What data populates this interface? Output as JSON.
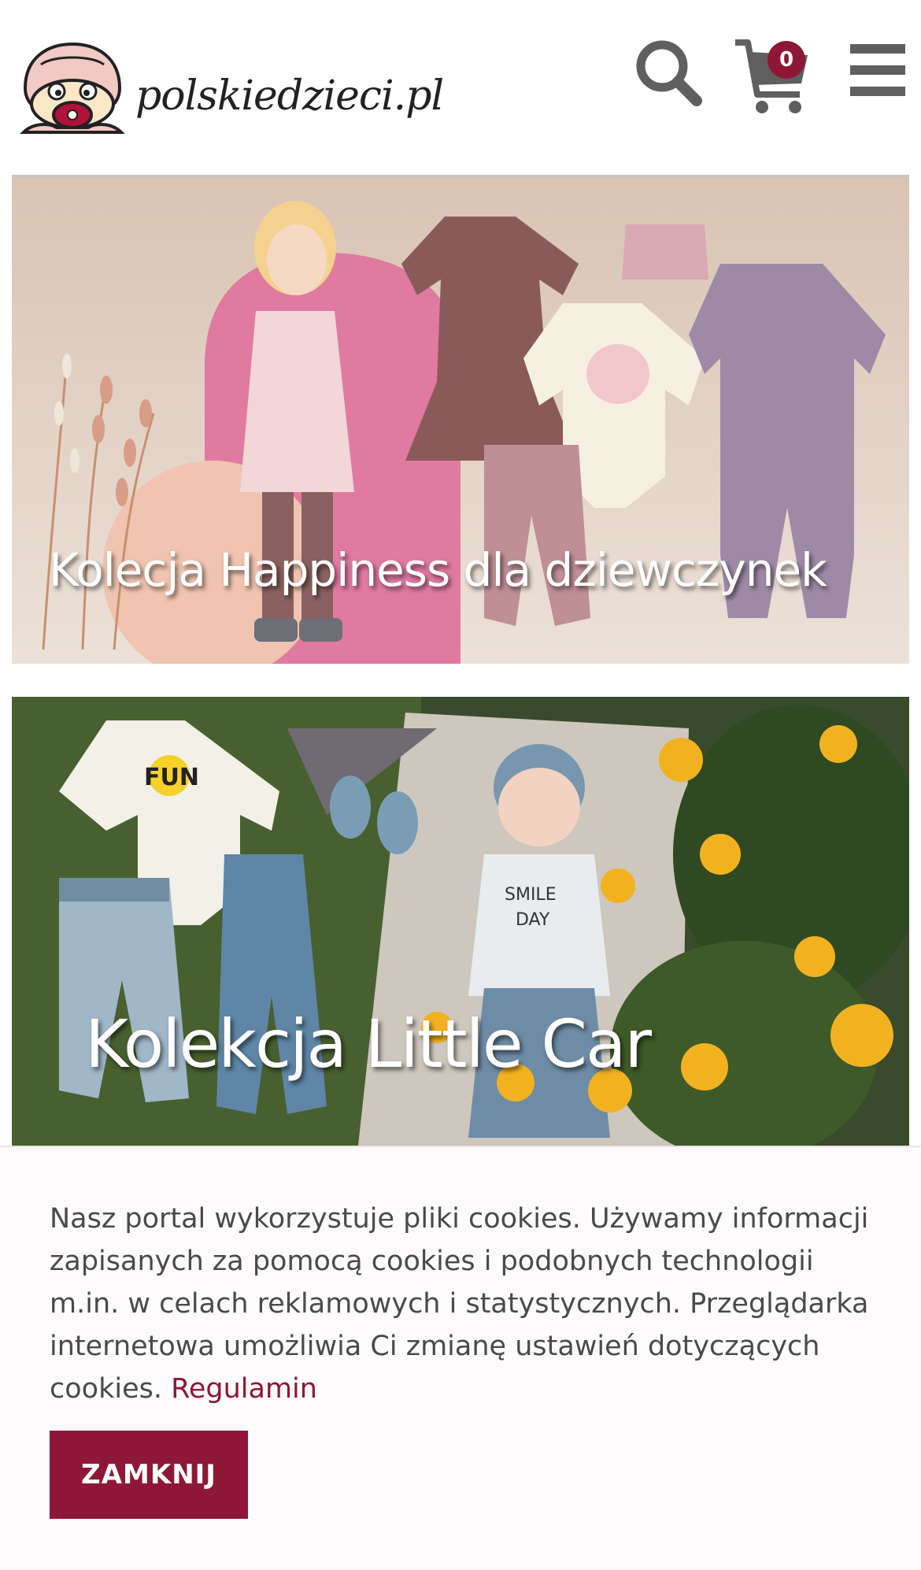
{
  "header": {
    "logo_text": "polskiedzieci.pl",
    "cart_count": "0"
  },
  "banners": [
    {
      "caption": "Kolecja Happiness dla dziewczynek"
    },
    {
      "caption": "Kolekcja Little Car"
    }
  ],
  "cookie": {
    "text": "Nasz portal wykorzystuje pliki cookies. Używamy informacji zapisanych za pomocą cookies i podobnych technologii m.in. w celach reklamowych i statystycznych. Przeglądarka internetowa umożliwia Ci zmianę ustawień dotyczących cookies.",
    "link_label": "Regulamin",
    "close_label": "ZAMKNIJ"
  },
  "colors": {
    "accent": "#8e1737",
    "icon_gray": "#5f5f5f"
  },
  "icons": [
    "logo-mascot-icon",
    "search-icon",
    "cart-icon",
    "hamburger-menu-icon"
  ]
}
